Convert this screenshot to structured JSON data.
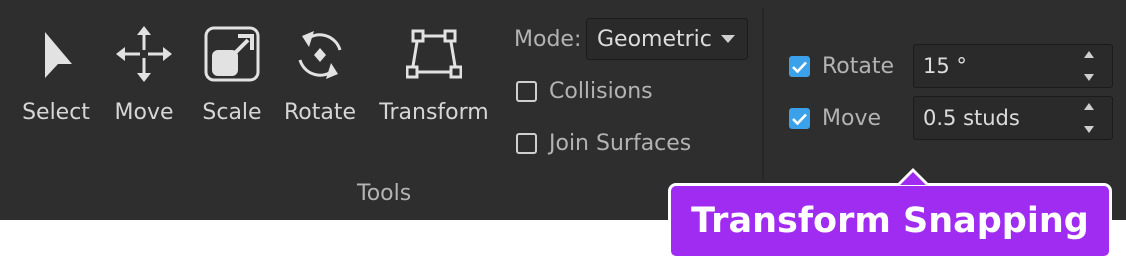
{
  "tools": {
    "items": [
      {
        "label": "Select",
        "icon": "cursor-arrow-icon"
      },
      {
        "label": "Move",
        "icon": "move-arrows-icon"
      },
      {
        "label": "Scale",
        "icon": "scale-icon"
      },
      {
        "label": "Rotate",
        "icon": "rotate-icon"
      },
      {
        "label": "Transform",
        "icon": "transform-icon"
      }
    ],
    "group_label": "Tools"
  },
  "options": {
    "mode_label": "Mode:",
    "mode_value": "Geometric",
    "collisions_label": "Collisions",
    "collisions_checked": false,
    "join_surfaces_label": "Join Surfaces",
    "join_surfaces_checked": false
  },
  "snapping": {
    "rotate_label": "Rotate",
    "rotate_checked": true,
    "rotate_value": "15 °",
    "move_label": "Move",
    "move_checked": true,
    "move_value": "0.5 studs"
  },
  "callout": {
    "text": "Transform Snapping",
    "color": "#a02cf2"
  },
  "colors": {
    "toolbar_bg": "#2e2e2e",
    "checkbox_on": "#3aa1ea"
  }
}
